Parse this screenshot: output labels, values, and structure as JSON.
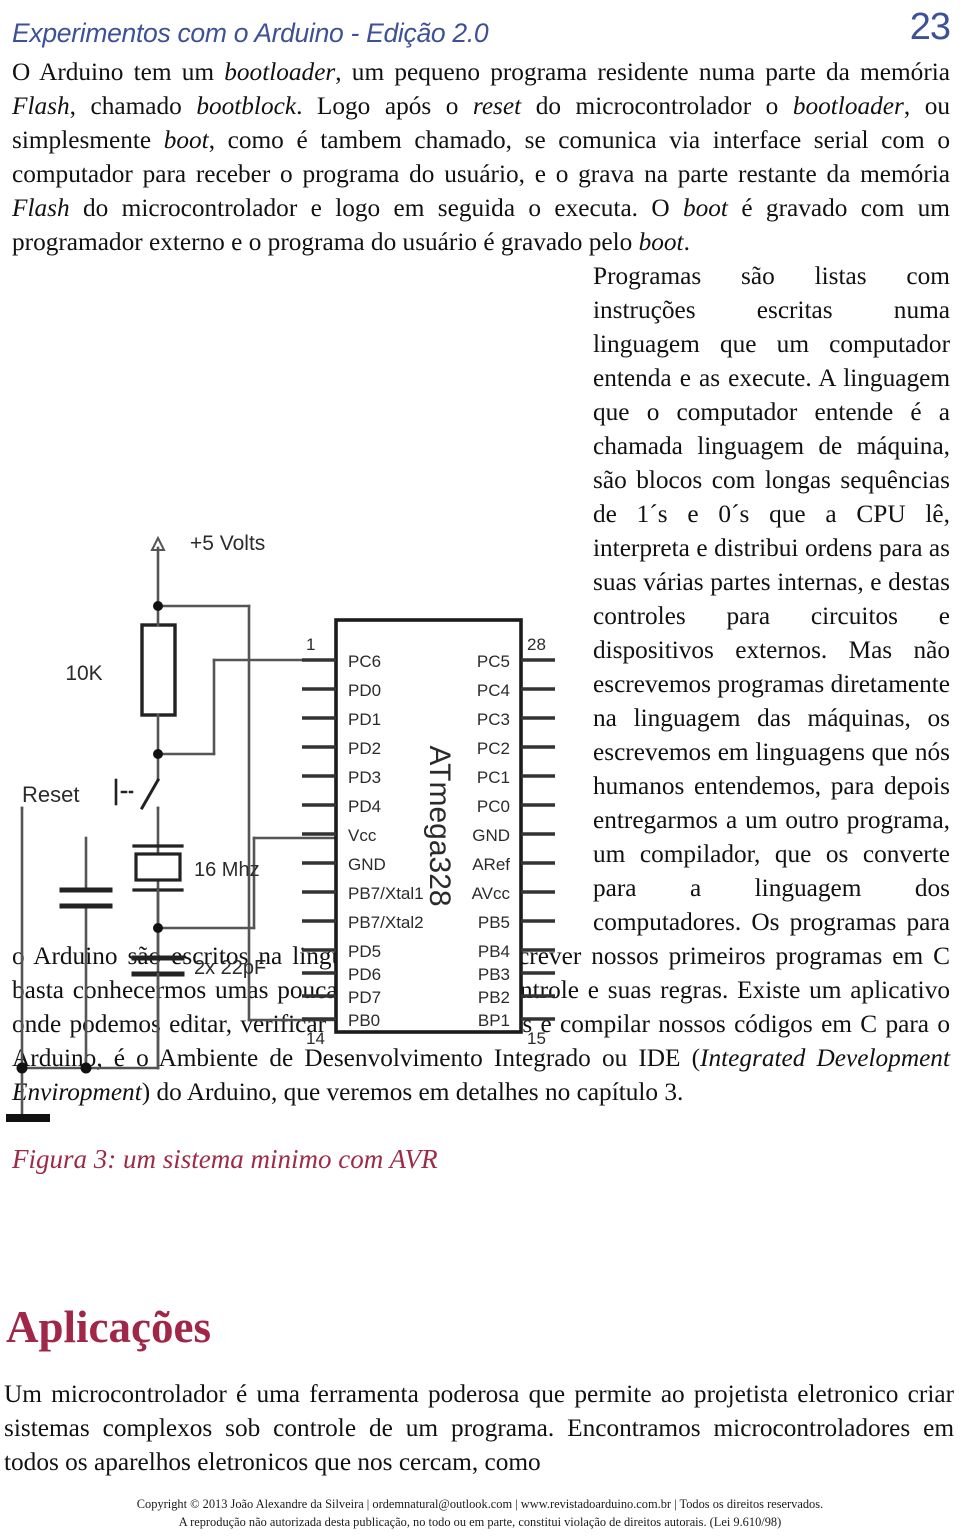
{
  "header": {
    "title": "Experimentos com o Arduino - Edição 2.0",
    "page_number": "23",
    "accent_color": "#3d5199"
  },
  "main": {
    "paragraph_1": "O Arduino tem um bootloader, um pequeno programa residente numa parte da memória Flash, chamado bootblock. Logo após o reset do microcontrolador o bootloader, ou simplesmente boot, como é tambem chamado, se comunica via interface serial com o computador  para receber o programa do usuário, e o grava na parte restante da memória Flash do microcontrolador e logo em seguida o executa. O boot é gravado com um programador externo e o programa do usuário é gravado pelo boot.",
    "paragraph_1_parts": {
      "t1": "O Arduino tem um ",
      "i1": "bootloader",
      "t2": ", um pequeno programa residente numa parte da memória ",
      "i2": "Flash",
      "t3": ", chamado ",
      "i3": "bootblock",
      "t4": ". Logo após o ",
      "i4": "reset",
      "t5": " do microcontrolador o ",
      "i5": "bootloader",
      "t6": ", ou simplesmente ",
      "i6": "boot",
      "t7": ", como é tambem chamado, se comunica via interface serial com o computador  para receber o programa do usuário, e o grava na parte restante da memória ",
      "i7": "Flash",
      "t8": " do microcontrolador e logo em seguida o executa. O ",
      "i8": "boot",
      "t9": " é gravado com um programador externo e o programa do usuário é gravado pelo ",
      "i9": "boot",
      "t10": "."
    },
    "paragraph_2_parts": {
      "t1": "Programas são listas com instruções escritas numa linguagem que um computador entenda e as execute. A linguagem que o computador entende é a chamada linguagem de máquina, são blocos com longas sequências de 1´s e 0´s que a  CPU lê, interpreta e distribui ordens para as suas várias partes internas, e destas controles para circuitos e dispositivos externos. Mas não escrevemos programas diretamente na linguagem das máquinas, os escrevemos em linguagens que nós humanos entendemos, para depois entregarmos a um outro programa, um compilador, que os converte para a linguagem dos computadores. Os programas para o Arduino são escritos na linguagem C. Para escrever nossos primeiros programas em C basta conhecermos umas poucas estruturas de controle e suas regras. Existe um aplicativo onde podemos editar, verificar ocorrência de erros e compilar nossos códigos em C para o Arduino, é o  Ambiente de Desenvolvimento Integrado ou IDE (",
      "i1": "Integrated Development Enviropment",
      "t2": ") do Arduino, que veremos em detalhes no capítulo 3."
    }
  },
  "figure": {
    "caption": "Figura 3: um sistema minimo com AVR",
    "caption_color": "#9e2a46",
    "chip_name": "ATmega328",
    "supply_label": "+5 Volts",
    "resistor_label": "10K",
    "reset_label": "Reset",
    "crystal_label": "16 Mhz",
    "capacitor_label": "2x 22pF",
    "pin_numbers": {
      "top_left": "1",
      "top_right": "28",
      "bottom_left": "14",
      "bottom_right": "15"
    },
    "pins_left": [
      "PC6",
      "PD0",
      "PD1",
      "PD2",
      "PD3",
      "PD4",
      "Vcc",
      "GND",
      "PB7/Xtal1",
      "PB7/Xtal2",
      "PD5",
      "PD6",
      "PD7",
      "PB0"
    ],
    "pins_right": [
      "PC5",
      "PC4",
      "PC3",
      "PC2",
      "PC1",
      "PC0",
      "GND",
      "ARef",
      "AVcc",
      "PB5",
      "PB4",
      "PB3",
      "PB2",
      "BP1"
    ]
  },
  "section": {
    "heading": "Aplicações",
    "heading_color": "#a02748",
    "paragraph": "Um microcontrolador é uma ferramenta poderosa que permite ao projetista eletronico criar sistemas complexos sob controle de um programa. Encontramos microcontroladores em todos os aparelhos eletronicos que nos cercam, como"
  },
  "footer": {
    "line1": "Copyright © 2013 João Alexandre da Silveira | ordemnatural@outlook.com | www.revistadoarduino.com.br | Todos os direitos reservados.",
    "line2": "A reprodução não autorizada desta publicação, no todo ou em parte, constitui violação de direitos autorais. (Lei 9.610/98)"
  }
}
